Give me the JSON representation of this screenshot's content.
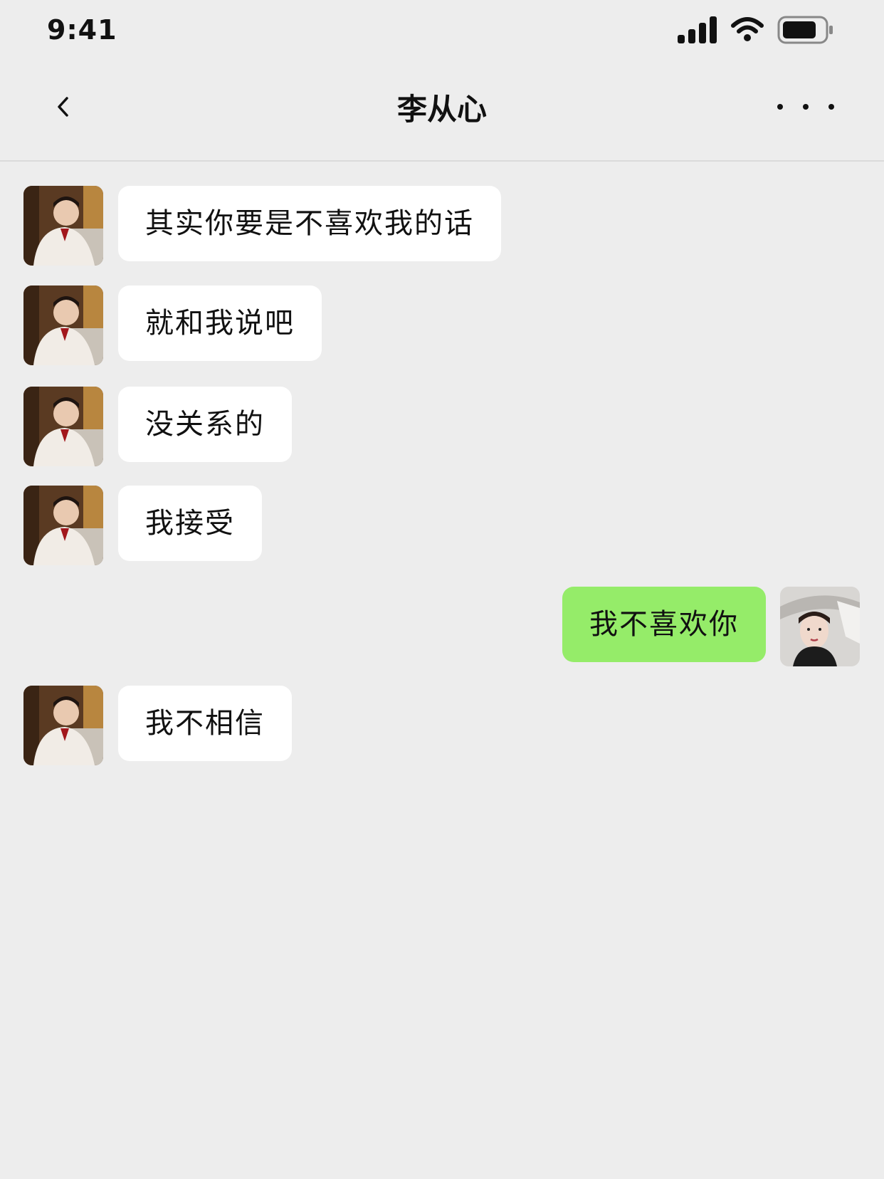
{
  "status_bar": {
    "time": "9:41"
  },
  "nav": {
    "title": "李从心"
  },
  "messages": [
    {
      "side": "in",
      "text": "其实你要是不喜欢我的话"
    },
    {
      "side": "in",
      "text": "就和我说吧"
    },
    {
      "side": "in",
      "text": "没关系的"
    },
    {
      "side": "in",
      "text": "我接受"
    },
    {
      "side": "out",
      "text": "我不喜欢你"
    },
    {
      "side": "in",
      "text": "我不相信"
    }
  ],
  "colors": {
    "background": "#EDEDED",
    "incoming_bubble": "#FFFFFF",
    "outgoing_bubble": "#95EC69"
  },
  "icons": {
    "back": "chevron-left-icon",
    "more": "more-dots-icon",
    "signal": "cellular-signal-icon",
    "wifi": "wifi-icon",
    "battery": "battery-icon"
  }
}
